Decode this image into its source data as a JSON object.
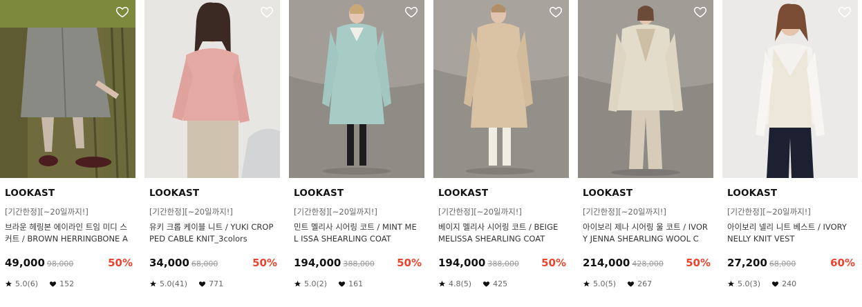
{
  "products": [
    {
      "brand": "LOOKAST",
      "promo": "[기간한정][~20일까지!]",
      "title": "브라운 헤링본 에이라인 트임 미디 스커트 / BROWN HERRINGBONE A ...",
      "price": "49,000",
      "original_price": "98,000",
      "discount": "50%",
      "rating": "5.0(6)",
      "likes": "152"
    },
    {
      "brand": "LOOKAST",
      "promo": "[기간한정][~20일까지!]",
      "title": "유키 크롭 케이블 니트 / YUKI CROP PED CABLE KNIT_3colors",
      "price": "34,000",
      "original_price": "68,000",
      "discount": "50%",
      "rating": "5.0(41)",
      "likes": "771"
    },
    {
      "brand": "LOOKAST",
      "promo": "[기간한정][~20일까지!]",
      "title": "민트 멜리사 시어링 코트 / MINT MEL ISSA SHEARLING COAT",
      "price": "194,000",
      "original_price": "388,000",
      "discount": "50%",
      "rating": "5.0(2)",
      "likes": "161"
    },
    {
      "brand": "LOOKAST",
      "promo": "[기간한정][~20일까지!]",
      "title": "베이지 멜리사 시어링 코트 / BEIGE MELISSA SHEARLING COAT",
      "price": "194,000",
      "original_price": "388,000",
      "discount": "50%",
      "rating": "4.8(5)",
      "likes": "425"
    },
    {
      "brand": "LOOKAST",
      "promo": "[기간한정][~20일까지!]",
      "title": "아이보리 제나 시어링 울 코트 / IVOR Y JENNA SHEARLING WOOL CO...",
      "price": "214,000",
      "original_price": "428,000",
      "discount": "50%",
      "rating": "5.0(5)",
      "likes": "267"
    },
    {
      "brand": "LOOKAST",
      "promo": "[기간한정][~20일까지!]",
      "title": "아이보리 넬리 니트 베스트 / IVORY NELLY KNIT VEST",
      "price": "27,200",
      "original_price": "68,000",
      "discount": "60%",
      "rating": "5.0(3)",
      "likes": "240"
    }
  ],
  "icons": {
    "wishlist": "heart-outline-icon",
    "rating": "star-icon",
    "likes": "heart-filled-icon"
  },
  "colors": {
    "discount": "#e8452e",
    "brand_text": "#111111",
    "muted": "#999999"
  }
}
